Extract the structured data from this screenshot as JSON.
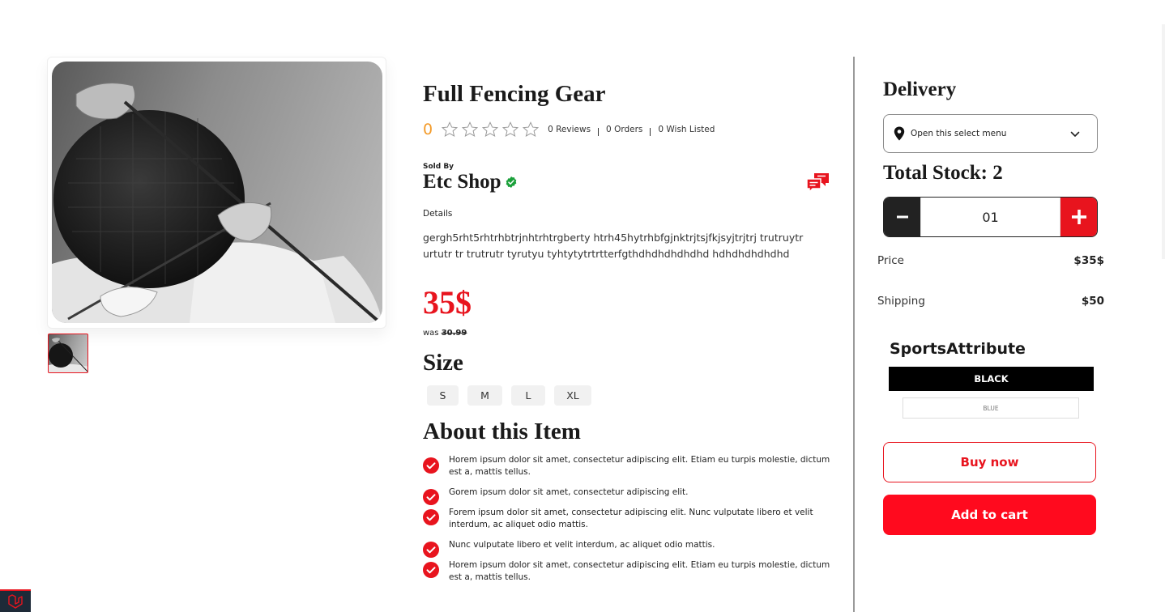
{
  "product": {
    "title": "Full Fencing Gear",
    "rating_value": "0",
    "reviews": "0 Reviews",
    "orders": "0 Orders",
    "wish_listed": "0 Wish Listed",
    "sold_by_label": "Sold By",
    "shop_name": "Etc Shop",
    "details_label": "Details",
    "details_text": "gergh5rht5rhtrhbtrjnhtrhtrgberty htrh45hytrhbfgjnktrjtsjfkjsyjtrjtrj trutruytrurtutr tr trutrutr tyrutyu tyhtytytrtrtterfgthdhdhdhdhdhd hdhdhdhdhdhd",
    "price": "35$",
    "was_label": "was",
    "was_price": "30.99",
    "size_label": "Size",
    "sizes": [
      "S",
      "M",
      "L",
      "XL"
    ],
    "about_label": "About this Item",
    "about_items": [
      "Horem ipsum dolor sit amet, consectetur adipiscing elit. Etiam eu turpis molestie, dictum est a, mattis tellus.",
      "Gorem ipsum dolor sit amet, consectetur adipiscing elit.",
      "Forem ipsum dolor sit amet, consectetur adipiscing elit. Nunc vulputate libero et velit interdum, ac aliquet odio mattis.",
      "Nunc vulputate libero et velit interdum, ac aliquet odio mattis.",
      "Horem ipsum dolor sit amet, consectetur adipiscing elit. Etiam eu turpis molestie, dictum est a, mattis tellus."
    ]
  },
  "sidebar": {
    "delivery_label": "Delivery",
    "delivery_select": "Open this select menu",
    "stock_label": "Total Stock: 2",
    "quantity": "01",
    "price_label": "Price",
    "price_value": "$35$",
    "shipping_label": "Shipping",
    "shipping_value": "$50",
    "attribute_title": "SportsAttribute",
    "attributes": [
      "BLACK",
      "BLUE"
    ],
    "buy_now": "Buy now",
    "add_to_cart": "Add to cart"
  },
  "colors": {
    "accent": "#e8141e",
    "rating": "#f39b2a",
    "verified": "#1aa03a"
  },
  "icons": [
    "star-icon",
    "verified-badge-icon",
    "chat-icon",
    "location-pin-icon",
    "chevron-down-icon",
    "minus-icon",
    "plus-icon",
    "check-circle-icon",
    "laravel-logo-icon"
  ]
}
